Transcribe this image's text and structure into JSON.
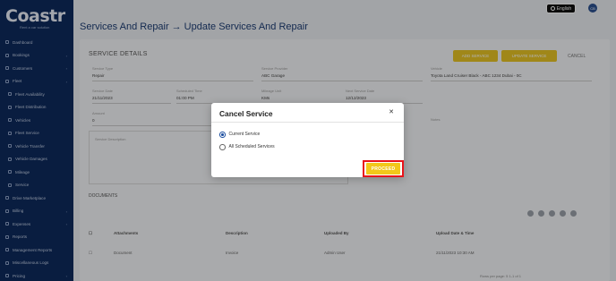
{
  "app": {
    "logo_text": "Coastr",
    "logo_subtext": "Rent a car solution"
  },
  "sidebar": {
    "items": [
      {
        "label": "Dashboard",
        "icon": "grid-icon",
        "chevron": false,
        "sub": false
      },
      {
        "label": "Bookings",
        "icon": "calendar-icon",
        "chevron": true,
        "sub": false
      },
      {
        "label": "Customers",
        "icon": "users-icon",
        "chevron": true,
        "sub": false
      },
      {
        "label": "Fleet",
        "icon": "car-icon",
        "chevron": true,
        "sub": false
      },
      {
        "label": "Fleet Availability",
        "icon": "calendar-icon",
        "chevron": false,
        "sub": true
      },
      {
        "label": "Fleet Distribution",
        "icon": "map-icon",
        "chevron": false,
        "sub": true
      },
      {
        "label": "Vehicles",
        "icon": "car-icon",
        "chevron": false,
        "sub": true
      },
      {
        "label": "Fleet Service",
        "icon": "wrench-icon",
        "chevron": false,
        "sub": true
      },
      {
        "label": "Vehicle Transfer",
        "icon": "swap-icon",
        "chevron": false,
        "sub": true
      },
      {
        "label": "Vehicle Damages",
        "icon": "alert-icon",
        "chevron": false,
        "sub": true
      },
      {
        "label": "Mileage",
        "icon": "gauge-icon",
        "chevron": false,
        "sub": true
      },
      {
        "label": "Service",
        "icon": "tool-icon",
        "chevron": false,
        "sub": true
      },
      {
        "label": "Drive Marketplace",
        "icon": "store-icon",
        "chevron": false,
        "sub": false
      },
      {
        "label": "Billing",
        "icon": "card-icon",
        "chevron": true,
        "sub": false
      },
      {
        "label": "Expenses",
        "icon": "wallet-icon",
        "chevron": true,
        "sub": false
      },
      {
        "label": "Reports",
        "icon": "chart-icon",
        "chevron": false,
        "sub": false
      },
      {
        "label": "Management Reports",
        "icon": "file-icon",
        "chevron": false,
        "sub": false
      },
      {
        "label": "Miscellaneous Logs",
        "icon": "list-icon",
        "chevron": false,
        "sub": false
      },
      {
        "label": "Pricing",
        "icon": "tag-icon",
        "chevron": true,
        "sub": false
      }
    ]
  },
  "topbar": {
    "language": "English",
    "avatar_initials": "CB"
  },
  "page": {
    "title_parent": "Services And Repair",
    "title_current": "Update Services And Repair"
  },
  "service_details": {
    "title": "SERVICE DETAILS",
    "buttons": [
      "ADD SERVICE",
      "UPDATE SERVICE",
      "COMPLETE SERVICE"
    ],
    "cancel_label": "CANCEL",
    "fields": [
      {
        "label": "Service Type",
        "value": "Repair"
      },
      {
        "label": "Service Provider",
        "value": "ABC Garage"
      },
      {
        "label": "Vehicle",
        "value": "Toyota Land Cruiser Black - ABC 1234 Dubai - 0C"
      },
      {
        "label": "Service Date",
        "value": "21/11/2023"
      },
      {
        "label": "Scheduled Time",
        "value": "01:00 PM"
      },
      {
        "label": "Mileage Unit",
        "value": "KMs"
      },
      {
        "label": "Next Service Date",
        "value": "12/12/2023"
      },
      {
        "label": "Amount",
        "value": "0"
      },
      {
        "label": "Notes",
        "value": ""
      }
    ],
    "description_label": "Service Description"
  },
  "documents": {
    "title": "DOCUMENTS",
    "columns": [
      "Attachments",
      "Description",
      "Uploaded By",
      "Upload Date & Time"
    ],
    "rows": [
      [
        "Document",
        "Invoice",
        "Admin User",
        "21/11/2023 10:30 AM"
      ]
    ],
    "pagination": "Rows per page: 5   1-1 of 1"
  },
  "modal": {
    "title": "Cancel Service",
    "close_icon": "close-icon",
    "options": [
      {
        "label": "Current Service",
        "checked": true
      },
      {
        "label": "All Scheduled Services",
        "checked": false
      }
    ],
    "proceed_label": "PROCEED",
    "colors": {
      "proceed": "#f2c81a",
      "highlight": "#e8141a",
      "radio": "#1d4fa0"
    }
  }
}
